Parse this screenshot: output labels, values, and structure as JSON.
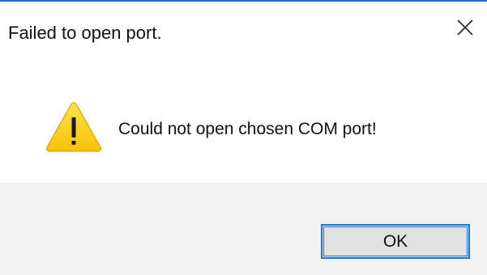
{
  "dialog": {
    "title": "Failed to open port.",
    "message": "Could not open chosen COM port!",
    "icon": "warning-icon",
    "close_icon": "close-icon",
    "ok_label": "OK"
  },
  "colors": {
    "accent": "#1f72d6",
    "warning_fill": "#fcd215",
    "footer_bg": "#f0f0f0"
  }
}
